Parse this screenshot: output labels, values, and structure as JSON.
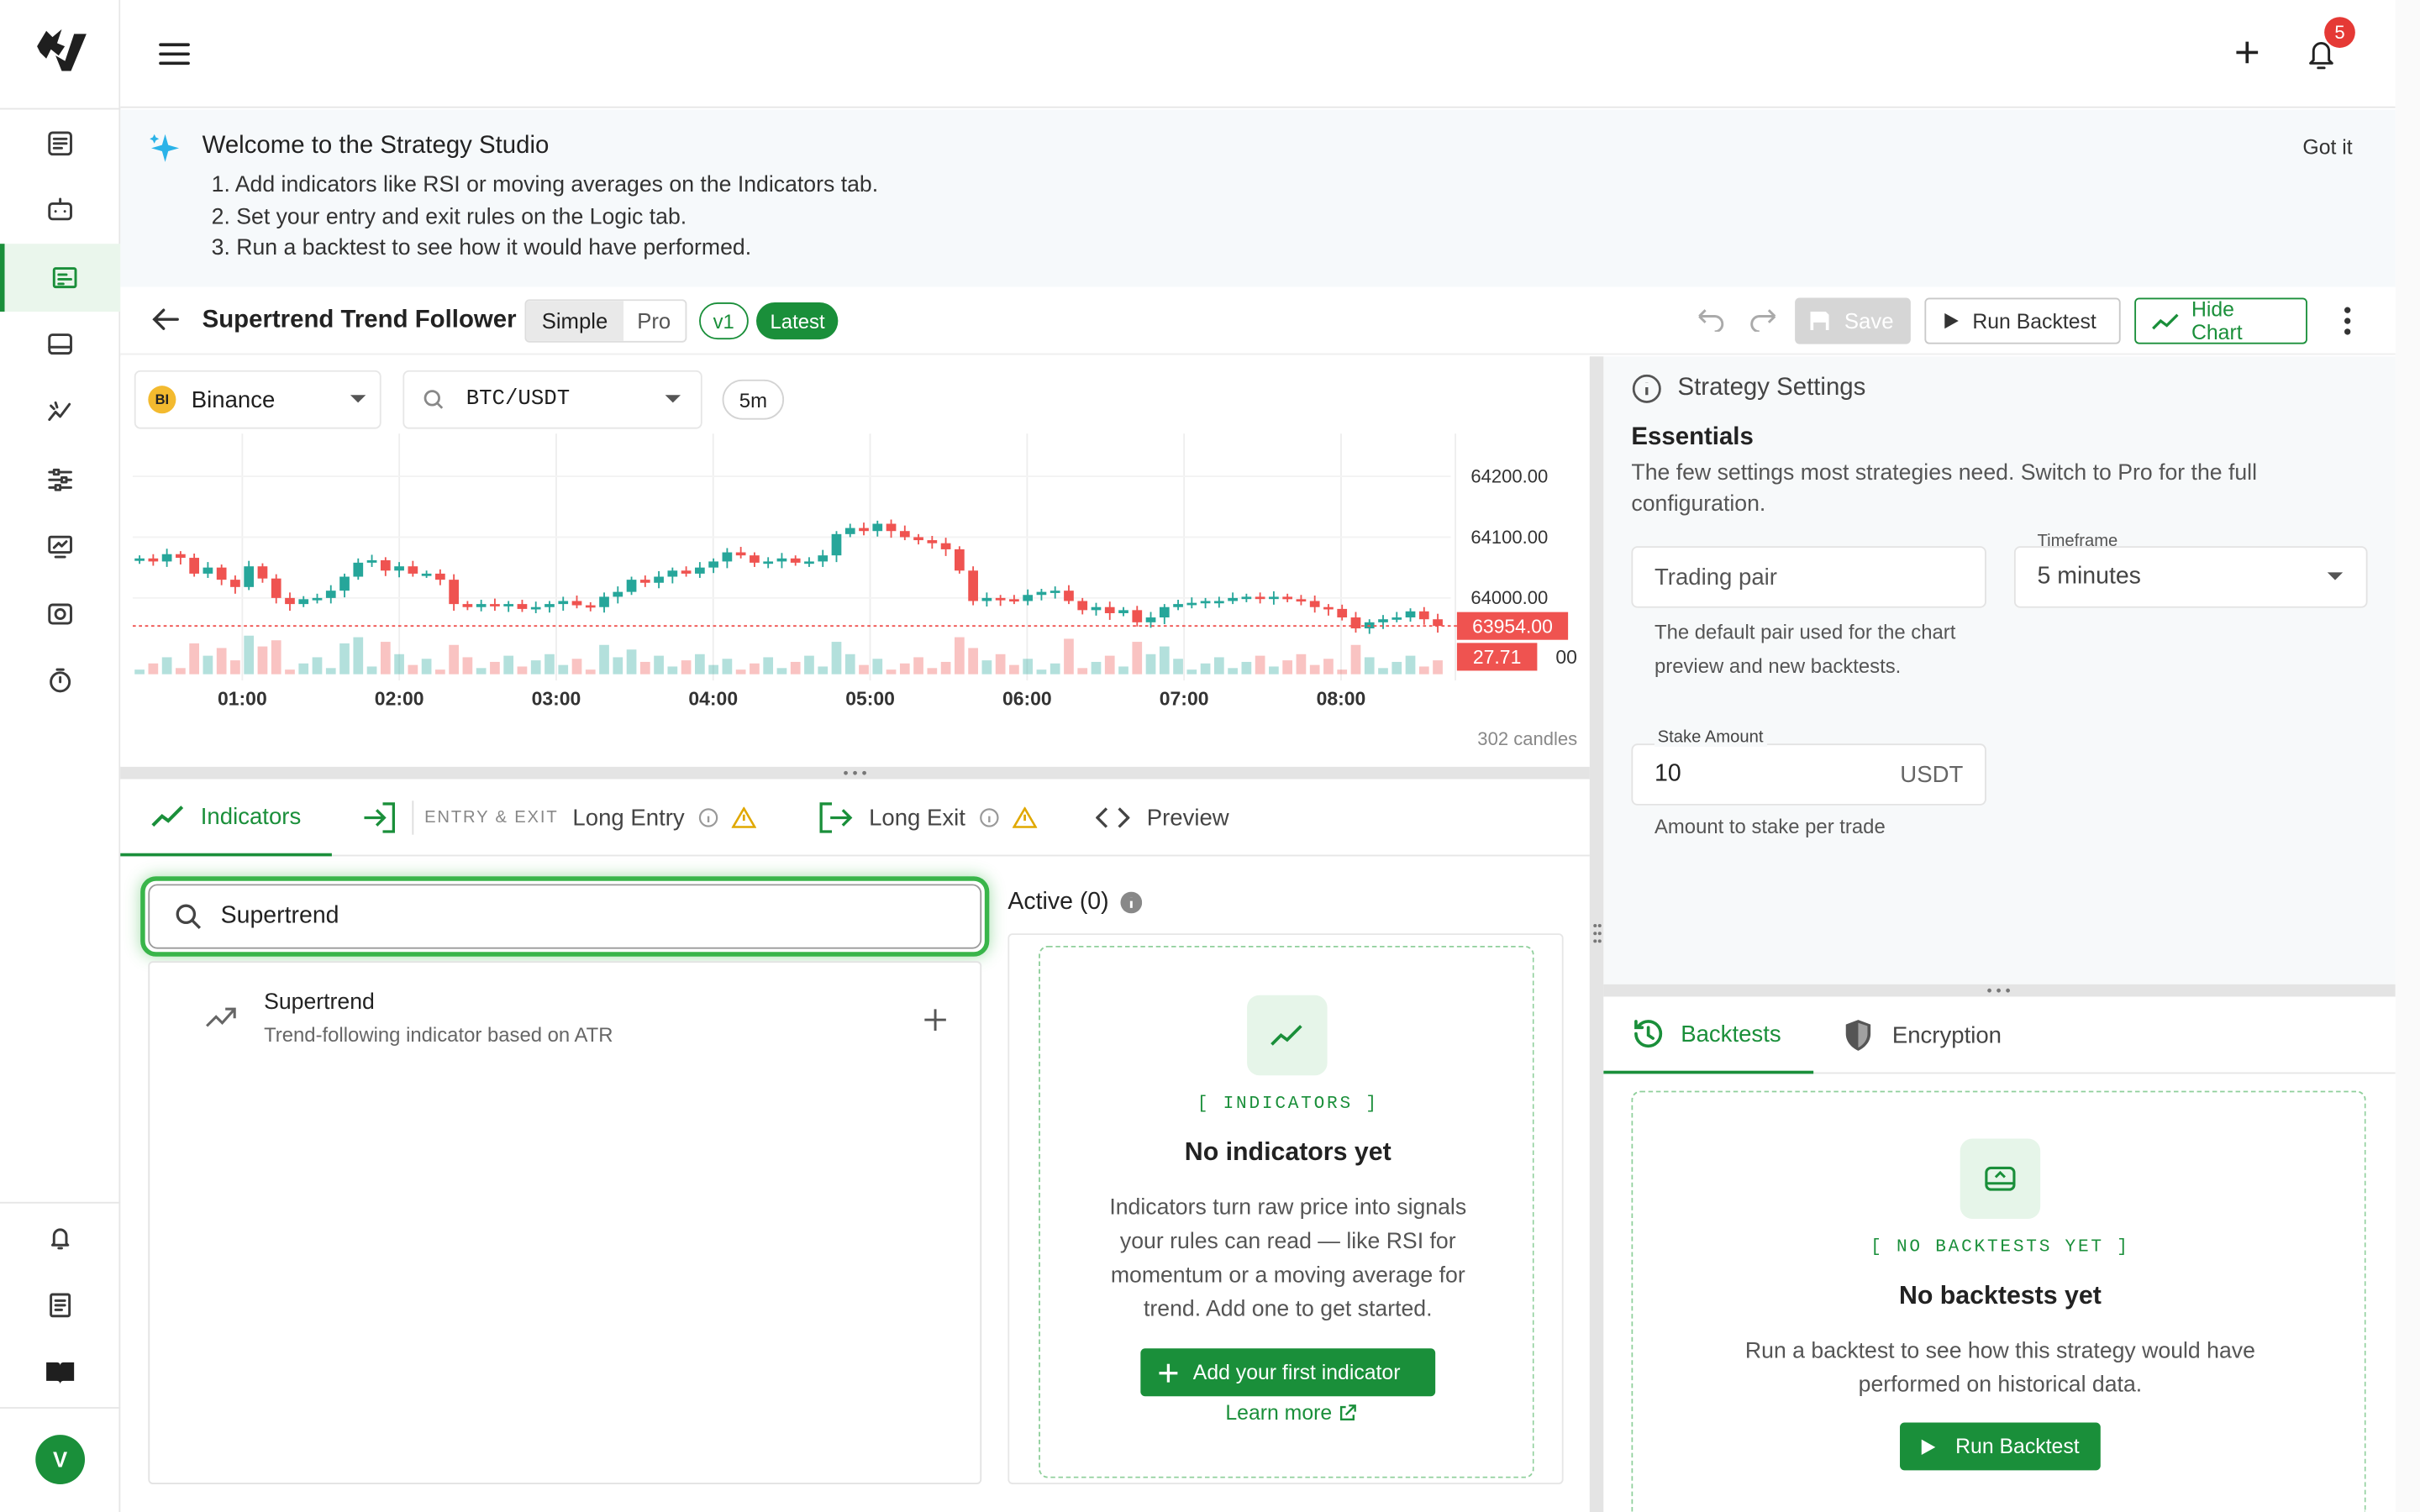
{
  "app": {
    "logo": "horse-logo"
  },
  "header": {
    "notif_count": "5"
  },
  "banner": {
    "title": "Welcome to the Strategy Studio",
    "steps": [
      "1. Add indicators like RSI or moving averages on the Indicators tab.",
      "2. Set your entry and exit rules on the Logic tab.",
      "3. Run a backtest to see how it would have performed."
    ],
    "dismiss": "Got it"
  },
  "strategy": {
    "name": "Supertrend Trend Follower",
    "mode_simple": "Simple",
    "mode_pro": "Pro",
    "version": "v1",
    "latest": "Latest",
    "save": "Save",
    "run_backtest": "Run Backtest",
    "hide_chart": "Hide Chart"
  },
  "chart_toolbar": {
    "exchange_badge": "BI",
    "exchange": "Binance",
    "pair": "BTC/USDT",
    "timeframe": "5m"
  },
  "chart_data": {
    "type": "candlestick",
    "x_ticks": [
      "01:00",
      "02:00",
      "03:00",
      "04:00",
      "05:00",
      "06:00",
      "07:00",
      "08:00"
    ],
    "y_ticks": [
      "64200.00",
      "64100.00",
      "64000.00"
    ],
    "ylim": [
      63900,
      64250
    ],
    "last_price": "63954.00",
    "last_volume": "27.71",
    "candle_count": "302 candles",
    "closes": [
      64065,
      64060,
      64072,
      64066,
      64040,
      64050,
      64030,
      64018,
      64052,
      64032,
      64000,
      63990,
      63998,
      64000,
      64012,
      64035,
      64058,
      64062,
      64045,
      64052,
      64040,
      64040,
      64030,
      63990,
      63985,
      63990,
      63988,
      63990,
      63982,
      63985,
      63990,
      63995,
      63988,
      63985,
      64002,
      64010,
      64030,
      64025,
      64035,
      64045,
      64040,
      64050,
      64060,
      64075,
      64070,
      64058,
      64060,
      64065,
      64058,
      64060,
      64070,
      64105,
      64115,
      64110,
      64122,
      64110,
      64100,
      64095,
      64090,
      64080,
      64045,
      63995,
      64000,
      63998,
      63995,
      64005,
      64010,
      64012,
      63995,
      63980,
      63985,
      63975,
      63980,
      63960,
      63968,
      63985,
      63990,
      63992,
      63995,
      63995,
      64000,
      64002,
      64000,
      64002,
      63998,
      63995,
      63985,
      63982,
      63968,
      63950,
      63960,
      63965,
      63968,
      63978,
      63965,
      63954
    ]
  },
  "tabs": {
    "indicators": "Indicators",
    "entry_exit_label": "ENTRY & EXIT",
    "long_entry": "Long Entry",
    "long_exit": "Long Exit",
    "preview": "Preview"
  },
  "search": {
    "value": "Supertrend"
  },
  "search_result": {
    "name": "Supertrend",
    "desc": "Trend-following indicator based on ATR"
  },
  "active": {
    "title": "Active (0)",
    "tag": "[ INDICATORS ]",
    "heading": "No indicators yet",
    "body": "Indicators turn raw price into signals your rules can read — like RSI for momentum or a moving average for trend. Add one to get started.",
    "add": "Add your first indicator",
    "learn": "Learn more"
  },
  "settings": {
    "title": "Strategy Settings",
    "section": "Essentials",
    "section_desc": "The few settings most strategies need. Switch to Pro for the full configuration.",
    "pair_placeholder": "Trading pair",
    "pair_help": "The default pair used for the chart preview and new backtests.",
    "timeframe_label": "Timeframe",
    "timeframe_value": "5 minutes",
    "stake_label": "Stake Amount",
    "stake_value": "10",
    "stake_unit": "USDT",
    "stake_help": "Amount to stake per trade"
  },
  "backtests": {
    "tab_backtests": "Backtests",
    "tab_encryption": "Encryption",
    "tag": "[ NO BACKTESTS YET ]",
    "heading": "No backtests yet",
    "body": "Run a backtest to see how this strategy would have performed on historical data.",
    "run": "Run Backtest"
  },
  "colors": {
    "accent": "#1a8f3a",
    "up": "#26a69a",
    "down": "#ef5350",
    "badge": "#e53935"
  },
  "user": {
    "initial": "V"
  }
}
